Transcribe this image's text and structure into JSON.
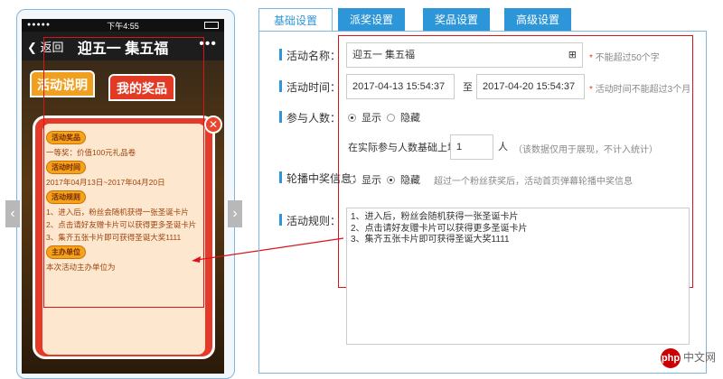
{
  "phone": {
    "status_time": "下午4:55",
    "back_label": "返回",
    "title": "迎五一 集五福",
    "more": "•••",
    "tab_rules": "活动说明",
    "tab_prizes": "我的奖品",
    "close": "✕",
    "modal": {
      "prize_heading": "活动奖品",
      "prize_text": "一等奖：价值100元礼品卷",
      "time_heading": "活动时间",
      "time_text": "2017年04月13日~2017年04月20日",
      "rules_heading": "活动规则",
      "rules": [
        "1、进入后，粉丝会随机获得一张圣诞卡片",
        "2、点击请好友赠卡片可以获得更多圣诞卡片",
        "3、集齐五张卡片即可获得圣诞大奖1111"
      ],
      "sponsor_heading": "主办单位",
      "sponsor_text": "本次活动主办单位为"
    }
  },
  "tabs": [
    "基础设置",
    "派奖设置",
    "奖品设置",
    "高级设置"
  ],
  "form": {
    "name_label": "活动名称：",
    "name_value": "迎五一 集五福",
    "name_hint": "不能超过50个字",
    "time_label": "活动时间：",
    "start": "2017-04-13 15:54:37",
    "to": "至",
    "end": "2017-04-20 15:54:37",
    "time_hint": "活动时间不能超过3个月",
    "count_label": "参与人数：",
    "show": "显示",
    "hide": "隐藏",
    "base_prefix": "在实际参与人数基础上增加",
    "base_value": "1",
    "base_unit": "人",
    "base_hint": "（该数据仅用于展现，不计入统计）",
    "carousel_label": "轮播中奖信息：",
    "carousel_hint": "超过一个粉丝获奖后，活动首页弹幕轮播中奖信息",
    "rules_label": "活动规则：",
    "rules": [
      "1、进入后，粉丝会随机获得一张圣诞卡片",
      "2、点击请好友赠卡片可以获得更多圣诞卡片",
      "3、集齐五张卡片即可获得圣诞大奖1111"
    ]
  },
  "watermark": "中文网",
  "watermark_logo": "php"
}
